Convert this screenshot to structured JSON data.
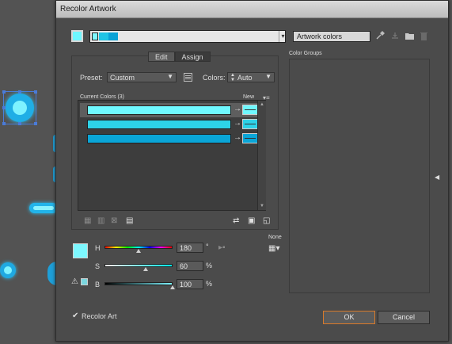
{
  "dialog": {
    "title": "Recolor Artwork",
    "artwork_name": "Artwork colors",
    "harmony_colors": [
      "#7ef7ff",
      "#1fc4e4",
      "#0aa2d6"
    ],
    "tabs": [
      {
        "label": "Edit",
        "active": false
      },
      {
        "label": "Assign",
        "active": true
      }
    ],
    "preset_label": "Preset:",
    "preset_value": "Custom",
    "colors_label": "Colors:",
    "colors_value": "Auto",
    "current_colors_label": "Current Colors (3)",
    "new_label": "New",
    "color_rows": [
      {
        "current": "#6ff8ff",
        "new": "#6ff8ff",
        "selected": true
      },
      {
        "current": "#2dd3e8",
        "new": "#2dd3e8",
        "selected": false
      },
      {
        "current": "#0aa6d8",
        "new": "#0aa6d8",
        "selected": false
      }
    ],
    "none_label": "None",
    "sliders": {
      "h": {
        "label": "H",
        "value": "180",
        "unit": "°",
        "fraction": 0.5
      },
      "s": {
        "label": "S",
        "value": "60",
        "unit": "%",
        "fraction": 0.6
      },
      "b": {
        "label": "B",
        "value": "100",
        "unit": "%",
        "fraction": 1.0
      }
    },
    "color_groups_label": "Color Groups",
    "recolor_art_label": "Recolor Art",
    "recolor_art_checked": true,
    "ok_label": "OK",
    "cancel_label": "Cancel"
  },
  "icons": [
    "eyedropper-icon",
    "save-group-icon",
    "folder-icon",
    "trash-icon",
    "color-library-icon",
    "collapse-panel-icon",
    "warning-icon"
  ]
}
